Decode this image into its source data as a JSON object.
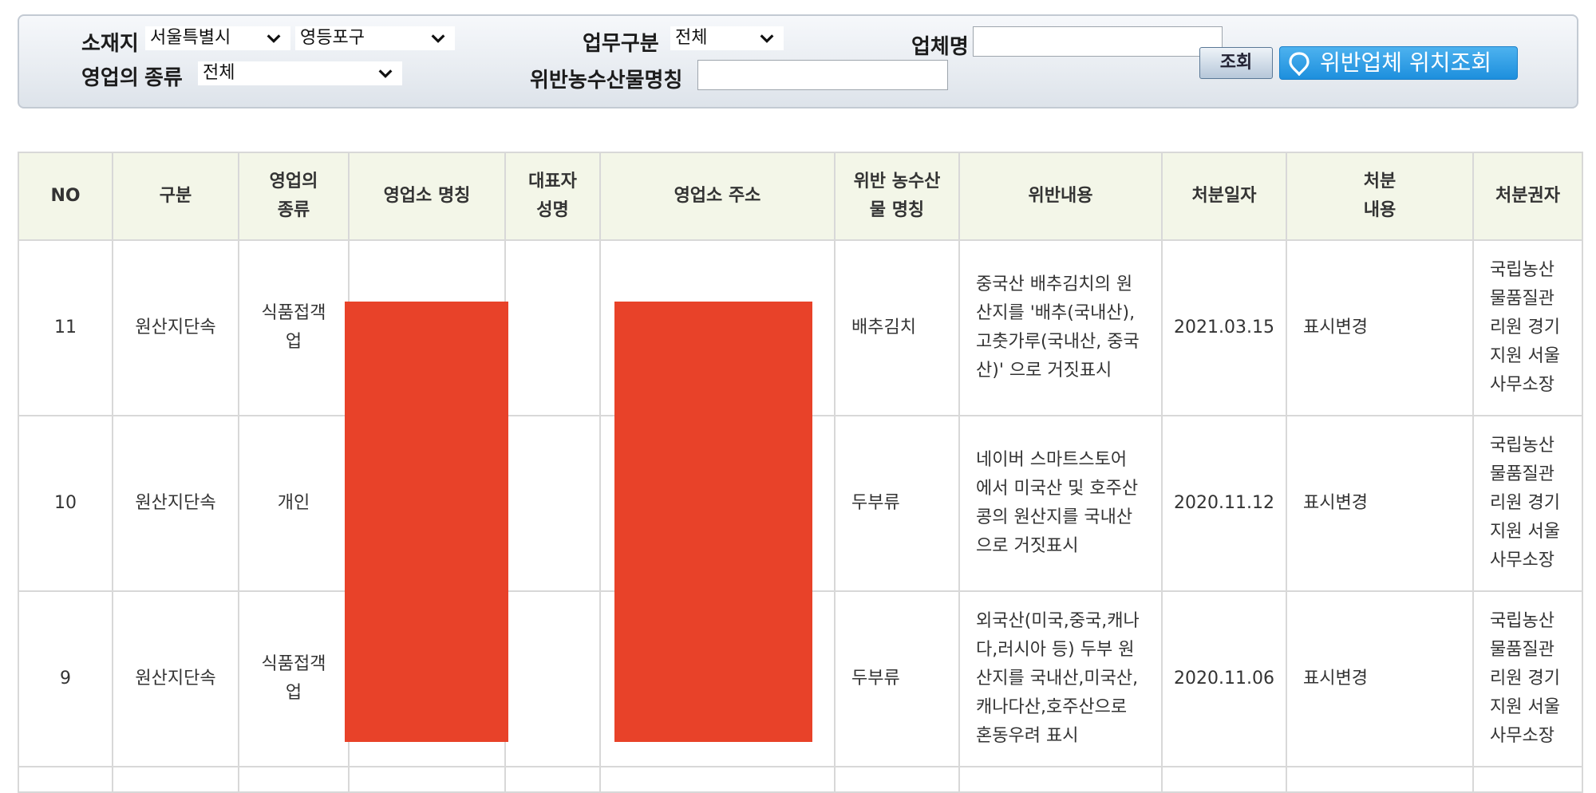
{
  "filters": {
    "location_label": "소재지",
    "city_value": "서울특별시",
    "district_value": "영등포구",
    "work_type_label": "업무구분",
    "work_type_value": "전체",
    "company_label": "업체명",
    "company_value": "",
    "business_type_label": "영업의 종류",
    "business_type_value": "전체",
    "product_label": "위반농수산물명칭",
    "product_value": "",
    "query_button": "조회",
    "map_button": "위반업체 위치조회"
  },
  "table": {
    "headers": [
      "NO",
      "구분",
      "영업의\n종류",
      "영업소 명칭",
      "대표자\n성명",
      "영업소 주소",
      "위반 농수산\n물 명칭",
      "위반내용",
      "처분일자",
      "처분\n내용",
      "처분권자"
    ],
    "rows": [
      {
        "no": "11",
        "category": "원산지단속",
        "business_type": "식품접객\n업",
        "name": "",
        "representative": "",
        "address": "",
        "product": "배추김치",
        "violation": "중국산 배추김치의 원\n산지를 '배추(국내산),\n고춧가루(국내산, 중국\n산)' 으로 거짓표시",
        "date": "2021.03.15",
        "disposition": "표시변경",
        "authority": "국립농산\n물품질관\n리원 경기\n지원 서울\n사무소장"
      },
      {
        "no": "10",
        "category": "원산지단속",
        "business_type": "개인",
        "name": "",
        "representative": "",
        "address": "",
        "product": "두부류",
        "violation": "네이버 스마트스토어\n에서 미국산 및 호주산\n콩의 원산지를 국내산\n으로 거짓표시",
        "date": "2020.11.12",
        "disposition": "표시변경",
        "authority": "국립농산\n물품질관\n리원 경기\n지원 서울\n사무소장"
      },
      {
        "no": "9",
        "category": "원산지단속",
        "business_type": "식품접객\n업",
        "name": "",
        "representative": "",
        "address": "",
        "product": "두부류",
        "violation": "외국산(미국,중국,캐나\n다,러시아 등) 두부 원\n산지를 국내산,미국산,\n캐나다산,호주산으로\n혼동우려 표시",
        "date": "2020.11.06",
        "disposition": "표시변경",
        "authority": "국립농산\n물품질관\n리원 경기\n지원 서울\n사무소장"
      }
    ]
  },
  "colors": {
    "redaction": "#e84229",
    "header_bg": "#f3f6e8",
    "map_button": "#1d8fdd"
  },
  "icons": {
    "dropdown": "chevron-down-icon",
    "map_button": "map-pin-icon"
  }
}
